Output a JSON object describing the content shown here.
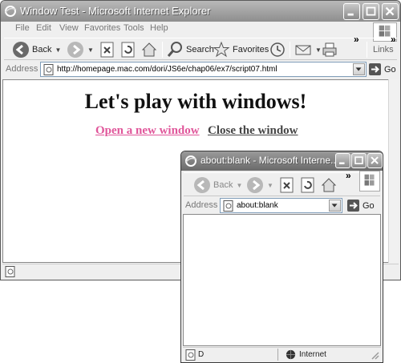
{
  "main_window": {
    "title": "Window Test - Microsoft Internet Explorer",
    "menu": [
      "File",
      "Edit",
      "View",
      "Favorites",
      "Tools",
      "Help"
    ],
    "toolbar": {
      "back_label": "Back",
      "search_label": "Search",
      "favorites_label": "Favorites",
      "links_label": "Links"
    },
    "address": {
      "label": "Address",
      "url": "http://homepage.mac.com/dori/JS6e/chap06/ex7/script07.html",
      "go_label": "Go"
    },
    "page": {
      "heading": "Let's play with windows!",
      "open_link": "Open a new window",
      "close_link": "Close the window"
    },
    "link_colors": {
      "open": "#e0569a",
      "close": "#444444"
    }
  },
  "popup_window": {
    "title": "about:blank - Microsoft Interne...",
    "toolbar": {
      "back_label": "Back"
    },
    "address": {
      "label": "Address",
      "url": "about:blank",
      "go_label": "Go"
    },
    "status": {
      "left_text": "D",
      "zone_text": "Internet"
    }
  }
}
